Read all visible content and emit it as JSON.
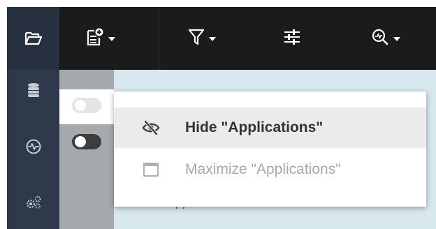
{
  "colors": {
    "rail_bg": "#2e3a4c",
    "toolbar_bg": "#1b1b1b",
    "content_bg": "#d7e8ee",
    "menu_hover_bg": "#ebebeb"
  },
  "rail": {
    "icons": [
      "folder-open-icon",
      "database-icon",
      "activity-icon",
      "cogs-icon"
    ]
  },
  "toolbar": {
    "icons": [
      "add-document-icon",
      "filter-icon",
      "sliders-icon",
      "zoom-icon"
    ]
  },
  "content": {
    "toggles": [
      {
        "state": "off"
      },
      {
        "state": "on"
      }
    ],
    "add_item_label": "baseapp"
  },
  "context_menu": {
    "items": [
      {
        "label": "Hide \"Applications\"",
        "icon": "eye-slash-icon",
        "enabled": true
      },
      {
        "label": "Maximize \"Applications\"",
        "icon": "window-maximize-icon",
        "enabled": false
      }
    ]
  }
}
